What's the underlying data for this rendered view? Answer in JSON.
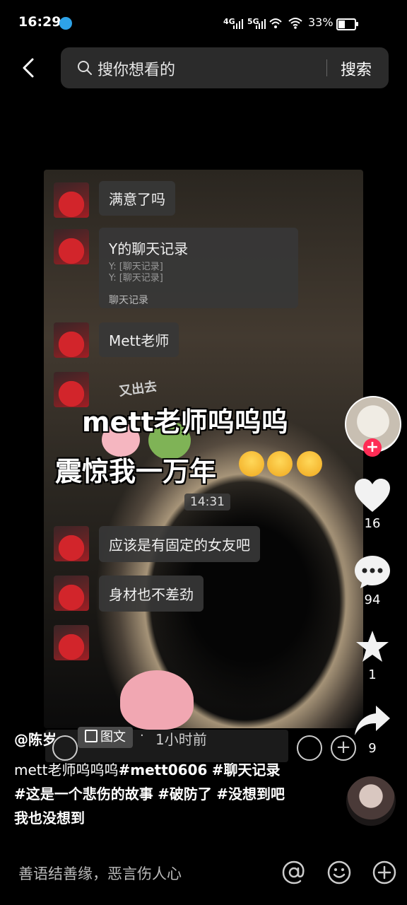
{
  "status_bar": {
    "time": "16:29",
    "network_1": "4G",
    "network_2": "5G",
    "battery": "33%"
  },
  "search": {
    "placeholder": "搜你想看的",
    "button": "搜索"
  },
  "chat": {
    "messages": [
      {
        "text": "满意了吗"
      },
      {
        "text": "Y的聊天记录",
        "sub1": "Y: [聊天记录]",
        "sub2": "Y: [聊天记录]",
        "footer": "聊天记录"
      },
      {
        "text": "Mett老师"
      },
      {
        "text": ""
      },
      {
        "text": "应该是有固定的女友吧"
      },
      {
        "text": "身材也不差劲"
      },
      {
        "text": ""
      }
    ],
    "timestamp": "14:31",
    "overlay_line1": "mett老师呜呜呜",
    "overlay_line2": "震惊我一万年",
    "sticker_text": "又出去"
  },
  "rail": {
    "likes": "16",
    "comments": "94",
    "favorites": "1",
    "shares": "9"
  },
  "post": {
    "author": "@陈岁",
    "type_tag": "图文",
    "time_ago": "1小时前",
    "caption_plain": "mett老师呜呜呜",
    "hashtags": [
      "#mett0606",
      "#聊天记录",
      "#这是一个悲伤的故事",
      "#破防了",
      "#没想到吧我也没想到"
    ]
  },
  "comment_bar": {
    "placeholder": "善语结善缘，恶言伤人心"
  },
  "colors": {
    "accent": "#fe2c55",
    "bubble": "#373737",
    "search_bg": "#2b2b2b"
  }
}
